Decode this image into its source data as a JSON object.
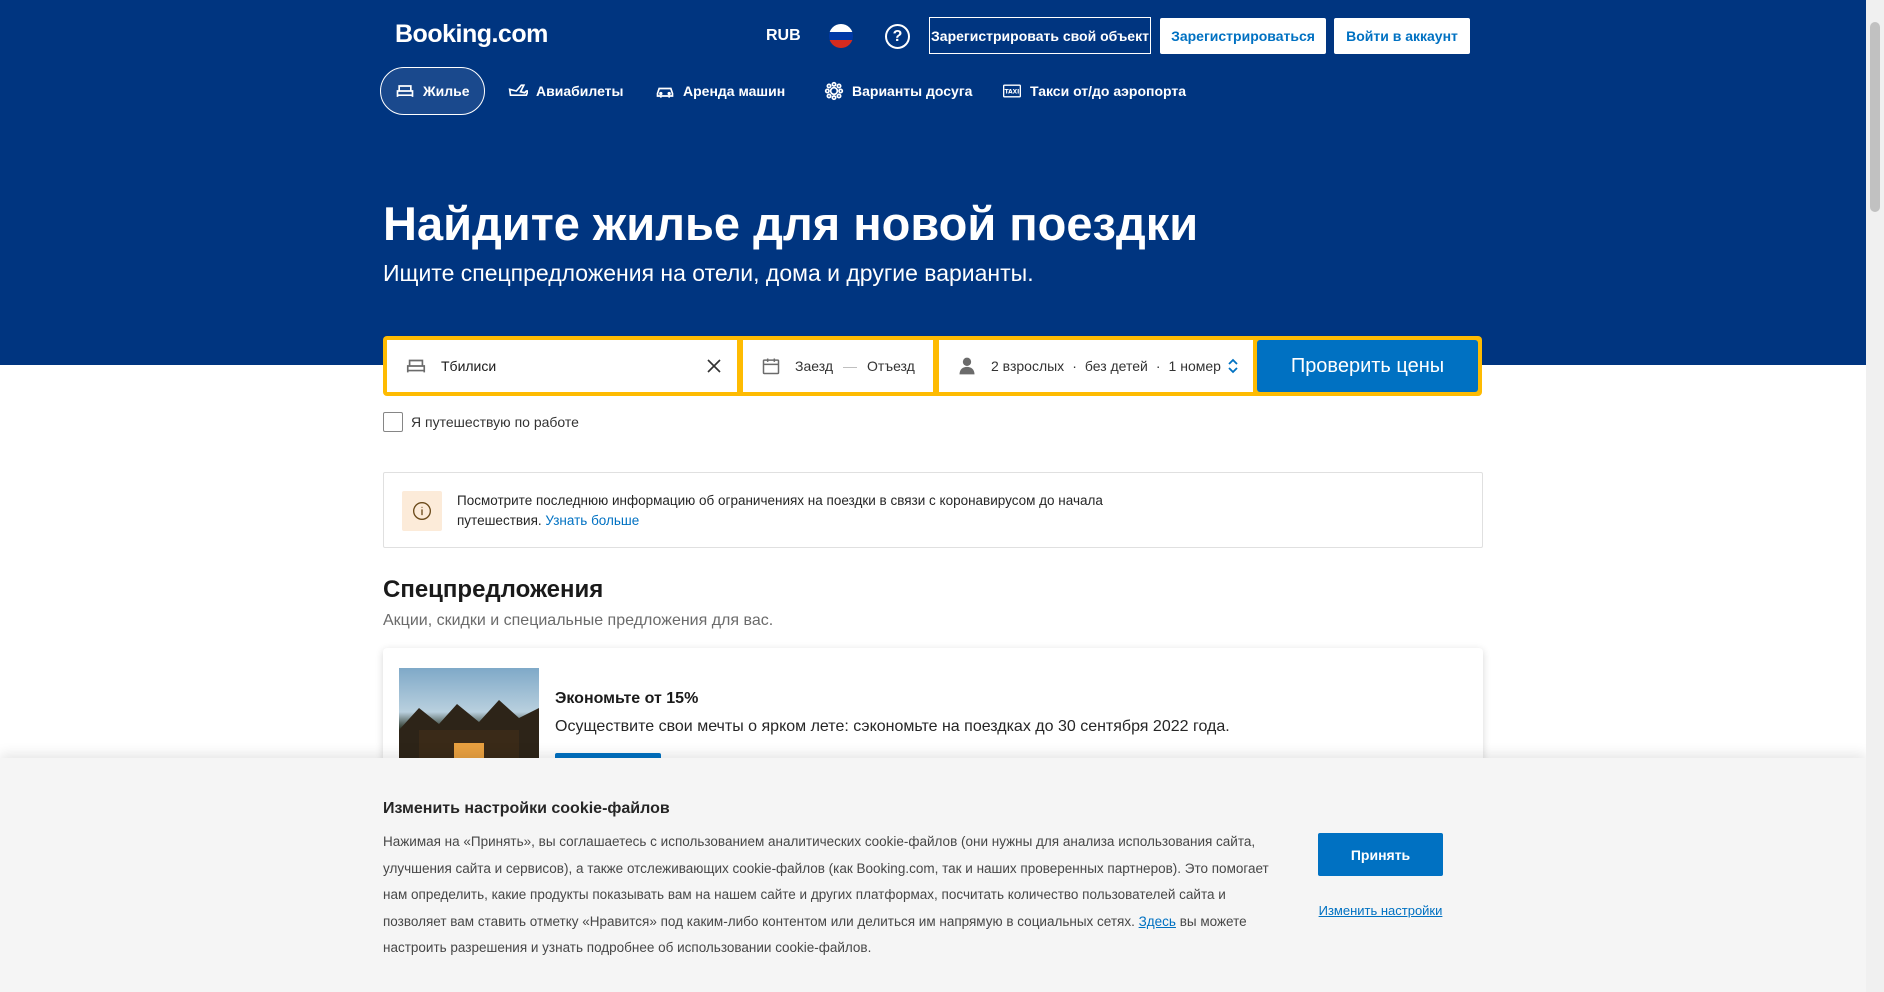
{
  "header": {
    "logo": "Booking.com",
    "currency": "RUB",
    "help": "?",
    "list_property": "Зарегистрировать свой объект",
    "register": "Зарегистрироваться",
    "sign_in": "Войти в аккаунт"
  },
  "nav": {
    "items": [
      {
        "label": "Жилье",
        "icon": "bed-icon",
        "active": true
      },
      {
        "label": "Авиабилеты",
        "icon": "plane-icon"
      },
      {
        "label": "Аренда машин",
        "icon": "car-icon"
      },
      {
        "label": "Варианты досуга",
        "icon": "attractions-icon"
      },
      {
        "label": "Такси от/до аэропорта",
        "icon": "taxi-icon"
      }
    ]
  },
  "hero": {
    "title": "Найдите жилье для новой поездки",
    "subtitle": "Ищите спецпредложения на отели, дома и другие варианты."
  },
  "search": {
    "destination": "Тбилиси",
    "checkin": "Заезд",
    "dash": "—",
    "checkout": "Отъезд",
    "adults": "2 взрослых",
    "sep": "·",
    "children": "без детей",
    "rooms": "1 номер",
    "submit": "Проверить цены",
    "business_travel": "Я путешествую по работе"
  },
  "alert": {
    "text": "Посмотрите последнюю информацию об ограничениях на поездки в связи с коронавирусом до начала путешествия.",
    "link": "Узнать больше"
  },
  "deals": {
    "title": "Спецпредложения",
    "subtitle": "Акции, скидки и специальные предложения для вас.",
    "card_title": "Экономьте от 15%",
    "card_desc": "Осуществите свои мечты о ярком лете: сэкономьте на поездках до 30 сентября 2022 года."
  },
  "cookie": {
    "title": "Изменить настройки cookie-файлов",
    "text_before_link": "Нажимая на «Принять», вы соглашаетесь с использованием аналитических cookie-файлов (они нужны для анализа использования сайта, улучшения сайта и сервисов), а также отслеживающих cookie-файлов (как Booking.com, так и наших проверенных партнеров). Это помогает нам определить, какие продукты показывать вам на нашем сайте и других платформах, посчитать количество пользователей сайта и позволяет вам ставить отметку «Нравится» под каким-либо контентом или делиться им напрямую в социальных сетях.",
    "link": "Здесь",
    "text_after_link": "вы можете настроить разрешения и узнать подробнее об использовании cookie-файлов.",
    "accept": "Принять",
    "settings": "Изменить настройки"
  },
  "colors": {
    "brand_blue": "#003580",
    "action_blue": "#0071c2",
    "search_border": "#febb02"
  }
}
